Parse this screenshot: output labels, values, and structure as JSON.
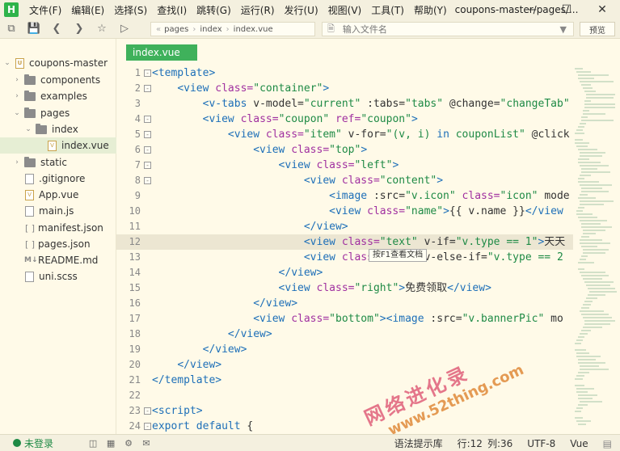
{
  "app": {
    "logo_letter": "H",
    "window_title": "coupons-master/pages/..."
  },
  "menu": [
    "文件(F)",
    "编辑(E)",
    "选择(S)",
    "查找(I)",
    "跳转(G)",
    "运行(R)",
    "发行(U)",
    "视图(V)",
    "工具(T)",
    "帮助(Y)"
  ],
  "toolbar": {
    "breadcrumb": [
      "pages",
      "index",
      "index.vue"
    ],
    "file_input_placeholder": "输入文件名",
    "preview_label": "预览"
  },
  "sidebar": {
    "project": "coupons-master",
    "items": [
      {
        "label": "components",
        "type": "folder"
      },
      {
        "label": "examples",
        "type": "folder"
      },
      {
        "label": "pages",
        "type": "folder"
      },
      {
        "label": "index",
        "type": "folder"
      },
      {
        "label": "index.vue",
        "type": "vue"
      },
      {
        "label": "static",
        "type": "folder"
      },
      {
        "label": ".gitignore",
        "type": "file"
      },
      {
        "label": "App.vue",
        "type": "vue"
      },
      {
        "label": "main.js",
        "type": "file"
      },
      {
        "label": "manifest.json",
        "type": "json"
      },
      {
        "label": "pages.json",
        "type": "json"
      },
      {
        "label": "README.md",
        "type": "md"
      },
      {
        "label": "uni.scss",
        "type": "file"
      }
    ]
  },
  "editor": {
    "tab_label": "index.vue",
    "tooltip": "按F1查看文档",
    "current_line": 12
  },
  "watermark": {
    "line1": "网络进化录",
    "line2": "www.52thing.com"
  },
  "status": {
    "login": "未登录",
    "syntax_lib": "语法提示库",
    "line": "行:12",
    "col": "列:36",
    "encoding": "UTF-8",
    "language": "Vue"
  }
}
